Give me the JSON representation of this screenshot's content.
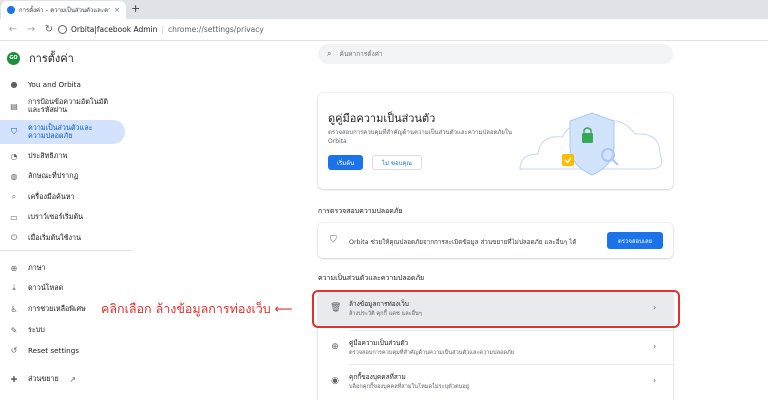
{
  "browser": {
    "tab_title": "การตั้งค่า – ความเป็นส่วนตัวและความ",
    "tab_close": "×",
    "new_tab": "+",
    "back": "←",
    "forward": "→",
    "reload": "↻",
    "site_label": "Orbita|facebook Admin",
    "url_sep": "|",
    "url": "chrome://settings/privacy"
  },
  "app": {
    "logo_text": "GO",
    "title": "การตั้งค่า"
  },
  "sidebar": {
    "items": [
      {
        "label": "You and Orbita",
        "icon": "person-icon"
      },
      {
        "label": "การป้อนข้อความอัตโนมัติและรหัสผ่าน",
        "icon": "clipboard-icon"
      },
      {
        "label": "ความเป็นส่วนตัวและความปลอดภัย",
        "icon": "shield-icon"
      },
      {
        "label": "ประสิทธิภาพ",
        "icon": "gauge-icon"
      },
      {
        "label": "ลักษณะที่ปรากฏ",
        "icon": "palette-icon"
      },
      {
        "label": "เครื่องมือค้นหา",
        "icon": "search-icon"
      },
      {
        "label": "เบราว์เซอร์เริ่มต้น",
        "icon": "browser-icon"
      },
      {
        "label": "เมื่อเริ่มต้นใช้งาน",
        "icon": "power-icon"
      },
      {
        "label": "ภาษา",
        "icon": "globe-icon"
      },
      {
        "label": "ดาวน์โหลด",
        "icon": "download-icon"
      },
      {
        "label": "การช่วยเหลือพิเศษ",
        "icon": "accessibility-icon"
      },
      {
        "label": "ระบบ",
        "icon": "wrench-icon"
      },
      {
        "label": "Reset settings",
        "icon": "reset-icon"
      },
      {
        "label": "ส่วนขยาย",
        "icon": "puzzle-icon"
      }
    ]
  },
  "search": {
    "placeholder": "ค้นหาการตั้งค่า"
  },
  "guide": {
    "title": "ดูคู่มือความเป็นส่วนตัว",
    "description": "ตรวจสอบการควบคุมที่สำคัญด้านความเป็นส่วนตัวและความปลอดภัยใน Orbita",
    "start_label": "เริ่มต้น",
    "dismiss_label": "ไม่ ขอบคุณ"
  },
  "safety_check": {
    "section_title": "การตรวจสอบความปลอดภัย",
    "text": "Orbita ช่วยให้คุณปลอดภัยจากการละเมิดข้อมูล ส่วนขยายที่ไม่ปลอดภัย และอื่นๆ ได้",
    "button_label": "ตรวจสอบเลย"
  },
  "privacy": {
    "section_title": "ความเป็นส่วนตัวและความปลอดภัย",
    "rows": [
      {
        "title": "ล้างข้อมูลการท่องเว็บ",
        "subtitle": "ล้างประวัติ คุกกี้ แคช และอื่นๆ",
        "icon": "trash-icon"
      },
      {
        "title": "คู่มือความเป็นส่วนตัว",
        "subtitle": "ตรวจสอบการควบคุมที่สำคัญด้านความเป็นส่วนตัวและความปลอดภัย",
        "icon": "add-circle-icon"
      },
      {
        "title": "คุกกี้ของบุคคลที่สาม",
        "subtitle": "บล็อกคุกกี้ของบุคคลที่สามในโหมดไม่ระบุตัวตนอยู่",
        "icon": "cookie-icon"
      }
    ],
    "chevron": "›"
  },
  "annotation": {
    "text": "คลิกเลือก ล้างข้อมูลการท่องเว็บ ⟵"
  },
  "colors": {
    "accent": "#1a73e8",
    "highlight": "#e0312e",
    "active_nav": "#d3e3fd"
  }
}
